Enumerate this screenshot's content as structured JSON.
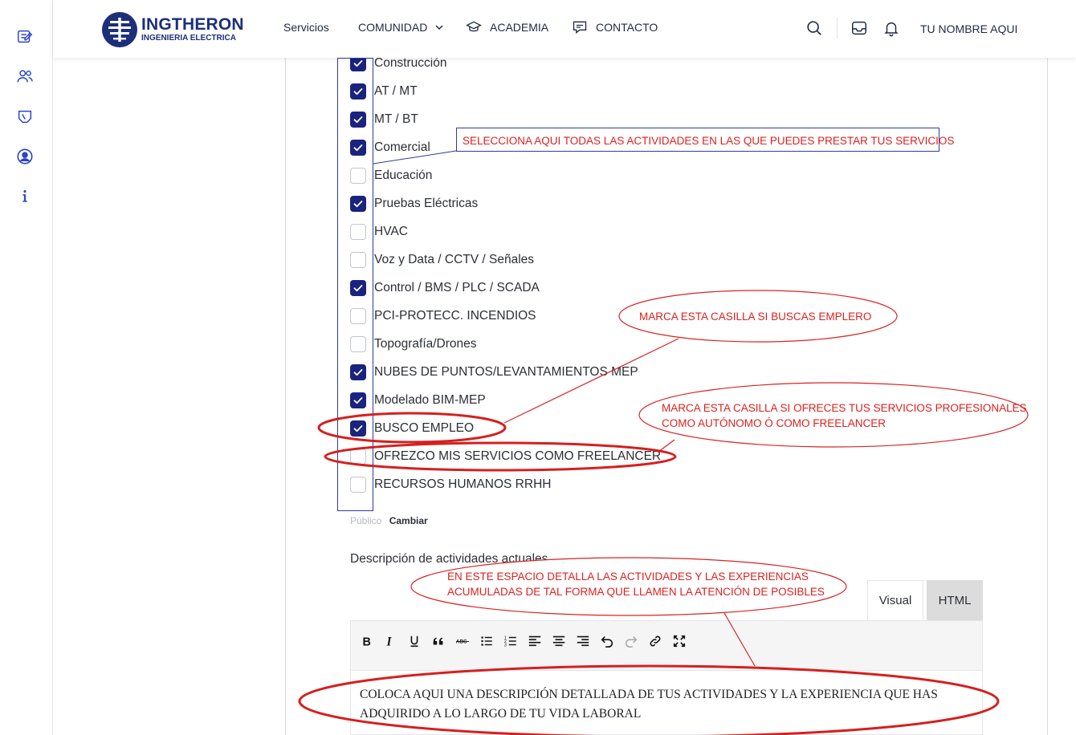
{
  "sidebar": {
    "items": [
      {
        "icon": "edit-document-icon"
      },
      {
        "icon": "users-icon"
      },
      {
        "icon": "tooth-icon"
      },
      {
        "icon": "user-circle-icon"
      },
      {
        "icon": "info-icon"
      }
    ]
  },
  "header": {
    "logo_name": "INGTHERON",
    "logo_sub": "INGENIERIA ELECTRICA",
    "nav": {
      "servicios": "Servicios",
      "comunidad": "COMUNIDAD",
      "academia": "ACADEMIA",
      "contacto": "CONTACTO"
    },
    "user_name": "TU NOMBRE AQUI"
  },
  "activities": [
    {
      "label": "Construcción",
      "checked": true
    },
    {
      "label": "AT / MT",
      "checked": true
    },
    {
      "label": "MT / BT",
      "checked": true
    },
    {
      "label": "Comercial",
      "checked": true
    },
    {
      "label": "Educación",
      "checked": false
    },
    {
      "label": "Pruebas Eléctricas",
      "checked": true
    },
    {
      "label": "HVAC",
      "checked": false
    },
    {
      "label": "Voz y Data / CCTV / Señales",
      "checked": false
    },
    {
      "label": "Control / BMS / PLC / SCADA",
      "checked": true
    },
    {
      "label": "PCI-PROTECC. INCENDIOS",
      "checked": false
    },
    {
      "label": "Topografía/Drones",
      "checked": false
    },
    {
      "label": "NUBES DE PUNTOS/LEVANTAMIENTOS MEP",
      "checked": true
    },
    {
      "label": "Modelado BIM-MEP",
      "checked": true
    },
    {
      "label": "BUSCO EMPLEO",
      "checked": true
    },
    {
      "label": "OFREZCO MIS SERVICIOS COMO FREELANCER",
      "checked": false
    },
    {
      "label": "RECURSOS HUMANOS RRHH",
      "checked": false
    }
  ],
  "visibility": {
    "label": "Público",
    "change": "Cambiar"
  },
  "description": {
    "label": "Descripción de actividades actuales...",
    "tabs": {
      "visual": "Visual",
      "html": "HTML"
    },
    "toolbar": [
      "bold-icon",
      "italic-icon",
      "underline-icon",
      "blockquote-icon",
      "strikethrough-icon",
      "bullet-list-icon",
      "numbered-list-icon",
      "align-left-icon",
      "align-center-icon",
      "align-right-icon",
      "undo-icon",
      "redo-icon",
      "link-icon",
      "fullscreen-icon"
    ],
    "content": "COLOCA AQUI UNA DESCRIPCIÓN DETALLADA DE TUS ACTIVIDADES Y LA EXPERIENCIA QUE HAS ADQUIRIDO A LO LARGO DE TU VIDA LABORAL"
  },
  "annotations": {
    "select_all": "SELECCIONA AQUI TODAS LAS ACTIVIDADES EN LAS QUE PUEDES PRESTAR TUS SERVICIOS",
    "job_search": "MARCA ESTA CASILLA SI BUSCAS EMPLERO",
    "freelance_line1": "MARCA ESTA CASILLA SI OFRECES TUS SERVICIOS PROFESIONALES",
    "freelance_line2": "COMO AUTÓNOMO Ó COMO FREELANCER",
    "detail_line1": "EN ESTE ESPACIO DETALLA LAS ACTIVIDADES Y LAS EXPERIENCIAS",
    "detail_line2": "ACUMULADAS DE TAL FORMA QUE LLAMEN LA ATENCIÓN DE POSIBLES"
  },
  "colors": {
    "brand": "#1d2f7a",
    "checkbox_checked": "#1a237e",
    "annotation_red": "#e0201f",
    "annotation_box": "#2f3b9f"
  }
}
